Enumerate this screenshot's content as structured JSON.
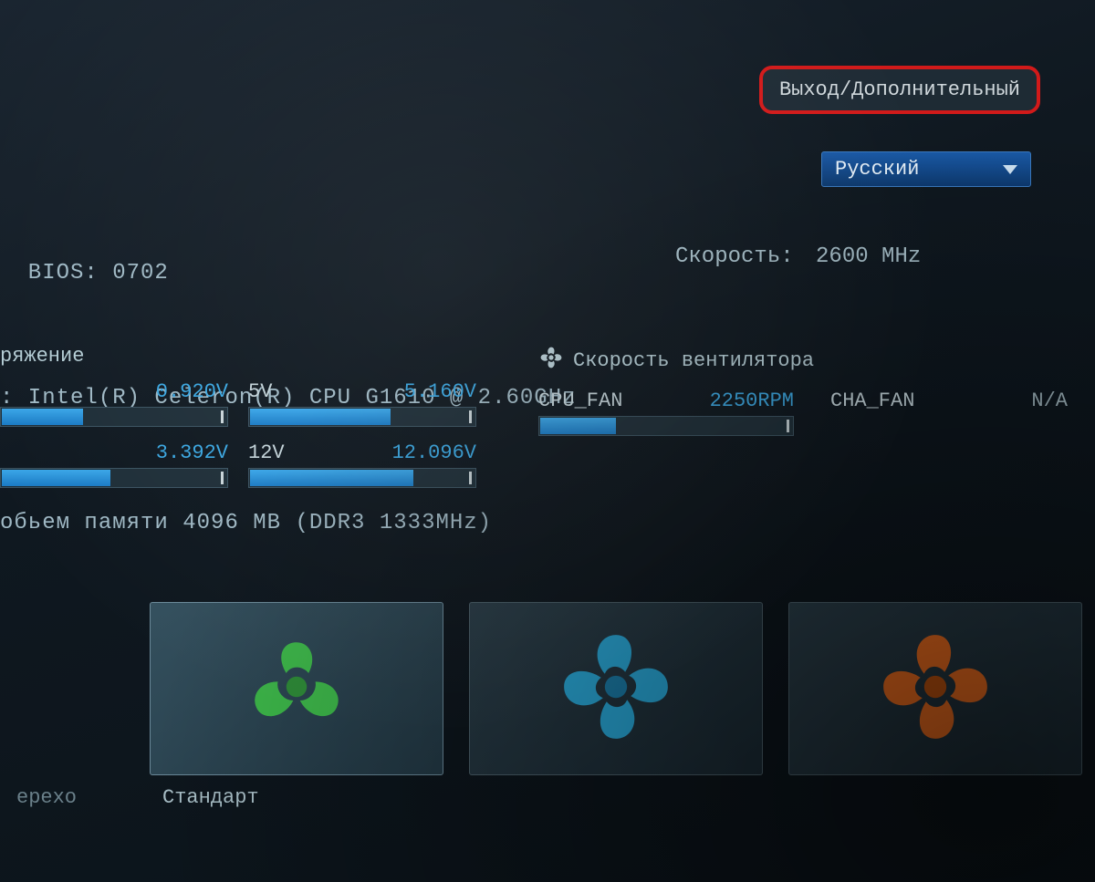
{
  "header": {
    "exit_button": "Выход/Дополнительный",
    "language": "Русский"
  },
  "system": {
    "bios_line": "  BIOS: 0702",
    "cpu_line": ": Intel(R) Celeron(R) CPU G1610 @ 2.60GHz",
    "mem_line": "обьем памяти 4096 MB (DDR3 1333MHz)",
    "speed_label": "Скорость:",
    "speed_value": "2600 MHz"
  },
  "voltage": {
    "title": "ряжение",
    "rails": [
      {
        "name": "",
        "value": "0.920V",
        "fill": 36
      },
      {
        "name": "5V",
        "value": "5.160V",
        "fill": 62
      },
      {
        "name": "",
        "value": "3.392V",
        "fill": 48
      },
      {
        "name": "12V",
        "value": "12.096V",
        "fill": 72
      }
    ]
  },
  "fan": {
    "title": "Скорость вентилятора",
    "cpu": {
      "name": "CPU_FAN",
      "value": "2250RPM",
      "fill": 30
    },
    "cha": {
      "name": "CHA_FAN",
      "value": "N/A"
    }
  },
  "profiles": {
    "left_cut_label": "ерехо",
    "items": [
      {
        "label": "Стандарт",
        "color": "#3db84a",
        "blades": 3,
        "selected": true
      },
      {
        "label": "",
        "color": "#29a8d8",
        "blades": 4,
        "selected": false
      },
      {
        "label": "",
        "color": "#e86a1e",
        "blades": 4,
        "selected": false
      }
    ]
  }
}
